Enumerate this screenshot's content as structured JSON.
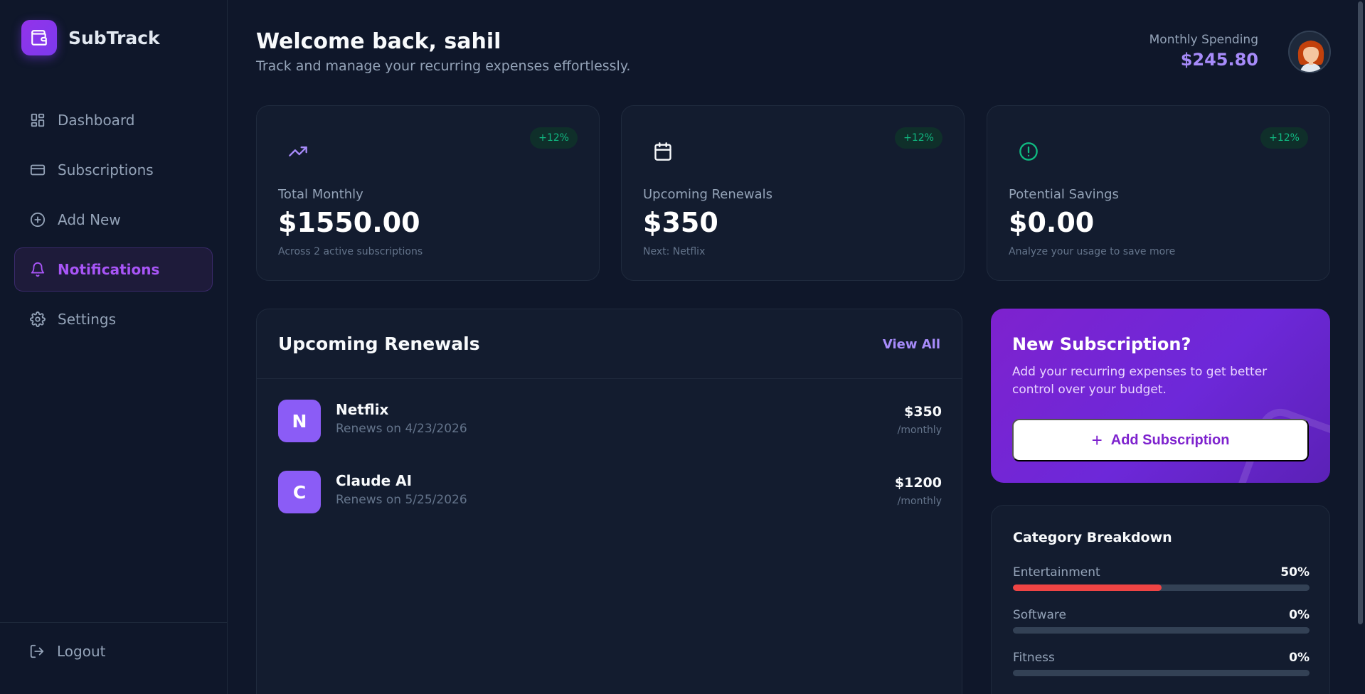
{
  "app": {
    "name": "SubTrack"
  },
  "sidebar": {
    "items": [
      {
        "label": "Dashboard",
        "icon": "grid-icon"
      },
      {
        "label": "Subscriptions",
        "icon": "card-icon"
      },
      {
        "label": "Add New",
        "icon": "plus-circle-icon"
      },
      {
        "label": "Notifications",
        "icon": "bell-icon",
        "active": true
      },
      {
        "label": "Settings",
        "icon": "gear-icon"
      }
    ],
    "logout": "Logout"
  },
  "header": {
    "welcome": "Welcome back, sahil",
    "subtitle": "Track and manage your recurring expenses effortlessly.",
    "spending_label": "Monthly Spending",
    "spending_value": "$245.80"
  },
  "stats": [
    {
      "icon": "trending-up-icon",
      "badge": "+12%",
      "label": "Total Monthly",
      "value": "$1550.00",
      "note": "Across 2 active subscriptions"
    },
    {
      "icon": "calendar-icon",
      "badge": "+12%",
      "label": "Upcoming Renewals",
      "value": "$350",
      "note": "Next: Netflix"
    },
    {
      "icon": "alert-circle-icon",
      "badge": "+12%",
      "label": "Potential Savings",
      "value": "$0.00",
      "note": "Analyze your usage to save more"
    }
  ],
  "renewals": {
    "title": "Upcoming Renewals",
    "view_all": "View All",
    "items": [
      {
        "letter": "N",
        "name": "Netflix",
        "date": "Renews on 4/23/2026",
        "price": "$350",
        "period": "/monthly"
      },
      {
        "letter": "C",
        "name": "Claude AI",
        "date": "Renews on 5/25/2026",
        "price": "$1200",
        "period": "/monthly"
      }
    ]
  },
  "promo": {
    "title": "New Subscription?",
    "text": "Add your recurring expenses to get better control over your budget.",
    "button": "Add Subscription"
  },
  "category": {
    "title": "Category Breakdown",
    "rows": [
      {
        "name": "Entertainment",
        "pct": "50%",
        "fill": 0.5
      },
      {
        "name": "Software",
        "pct": "0%",
        "fill": 0
      },
      {
        "name": "Fitness",
        "pct": "0%",
        "fill": 0
      }
    ]
  },
  "colors": {
    "accent": "#8b5cf6",
    "positive": "#10b981",
    "bar_fill": "#ef4444",
    "background": "#0f172a",
    "card": "#131c2f"
  }
}
